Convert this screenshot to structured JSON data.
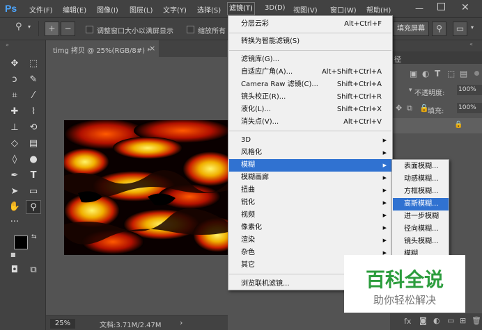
{
  "app": {
    "logo": "Ps"
  },
  "menubar": {
    "items": [
      "文件(F)",
      "编辑(E)",
      "图像(I)",
      "图层(L)",
      "文字(Y)",
      "选择(S)",
      "滤镜(T)",
      "3D(D)",
      "视图(V)",
      "窗口(W)",
      "帮助(H)"
    ],
    "active": "滤镜(T)"
  },
  "options": {
    "resize_label": "调整窗口大小以满屏显示",
    "zoom_all_label": "缩放所有",
    "fill_screen_label": "填充屏幕"
  },
  "document": {
    "tab_title": "timg 拷贝 @ 25%(RGB/8#) *",
    "tab_close": "×"
  },
  "status": {
    "zoom": "25%",
    "doc_info": "文档:3.71M/2.47M",
    "arrow": "›"
  },
  "panel": {
    "tab_fragment": "径",
    "opacity_label": "不透明度:",
    "opacity_value": "100%",
    "fill_label": "填充:",
    "fill_value": "100%"
  },
  "filter_menu": {
    "items": [
      {
        "label": "分层云彩",
        "shortcut": "Alt+Ctrl+F"
      },
      {
        "label": "转换为智能滤镜(S)",
        "shortcut": ""
      },
      {
        "label": "滤镜库(G)...",
        "shortcut": ""
      },
      {
        "label": "自适应广角(A)...",
        "shortcut": "Alt+Shift+Ctrl+A"
      },
      {
        "label": "Camera Raw 滤镜(C)...",
        "shortcut": "Shift+Ctrl+A"
      },
      {
        "label": "镜头校正(R)...",
        "shortcut": "Shift+Ctrl+R"
      },
      {
        "label": "液化(L)...",
        "shortcut": "Shift+Ctrl+X"
      },
      {
        "label": "消失点(V)...",
        "shortcut": "Alt+Ctrl+V"
      },
      {
        "label": "3D",
        "shortcut": ""
      },
      {
        "label": "风格化",
        "shortcut": ""
      },
      {
        "label": "模糊",
        "shortcut": ""
      },
      {
        "label": "模糊画廊",
        "shortcut": ""
      },
      {
        "label": "扭曲",
        "shortcut": ""
      },
      {
        "label": "锐化",
        "shortcut": ""
      },
      {
        "label": "视频",
        "shortcut": ""
      },
      {
        "label": "像素化",
        "shortcut": ""
      },
      {
        "label": "渲染",
        "shortcut": ""
      },
      {
        "label": "杂色",
        "shortcut": ""
      },
      {
        "label": "其它",
        "shortcut": ""
      },
      {
        "label": "浏览联机滤镜...",
        "shortcut": ""
      }
    ],
    "highlighted": "模糊"
  },
  "blur_submenu": {
    "items": [
      "表面模糊...",
      "动感模糊...",
      "方框模糊...",
      "高斯模糊...",
      "进一步模糊",
      "径向模糊...",
      "镜头模糊...",
      "模糊"
    ],
    "highlighted": "高斯模糊..."
  },
  "watermark": {
    "title": "百科全说",
    "subtitle": "助你轻松解决"
  },
  "colors": {
    "accent": "#3072d1",
    "ui_dark": "#424242",
    "canvas_bg": "#535353",
    "menu_bg": "#f0f0f0",
    "watermark_green": "#2c9d3d"
  }
}
